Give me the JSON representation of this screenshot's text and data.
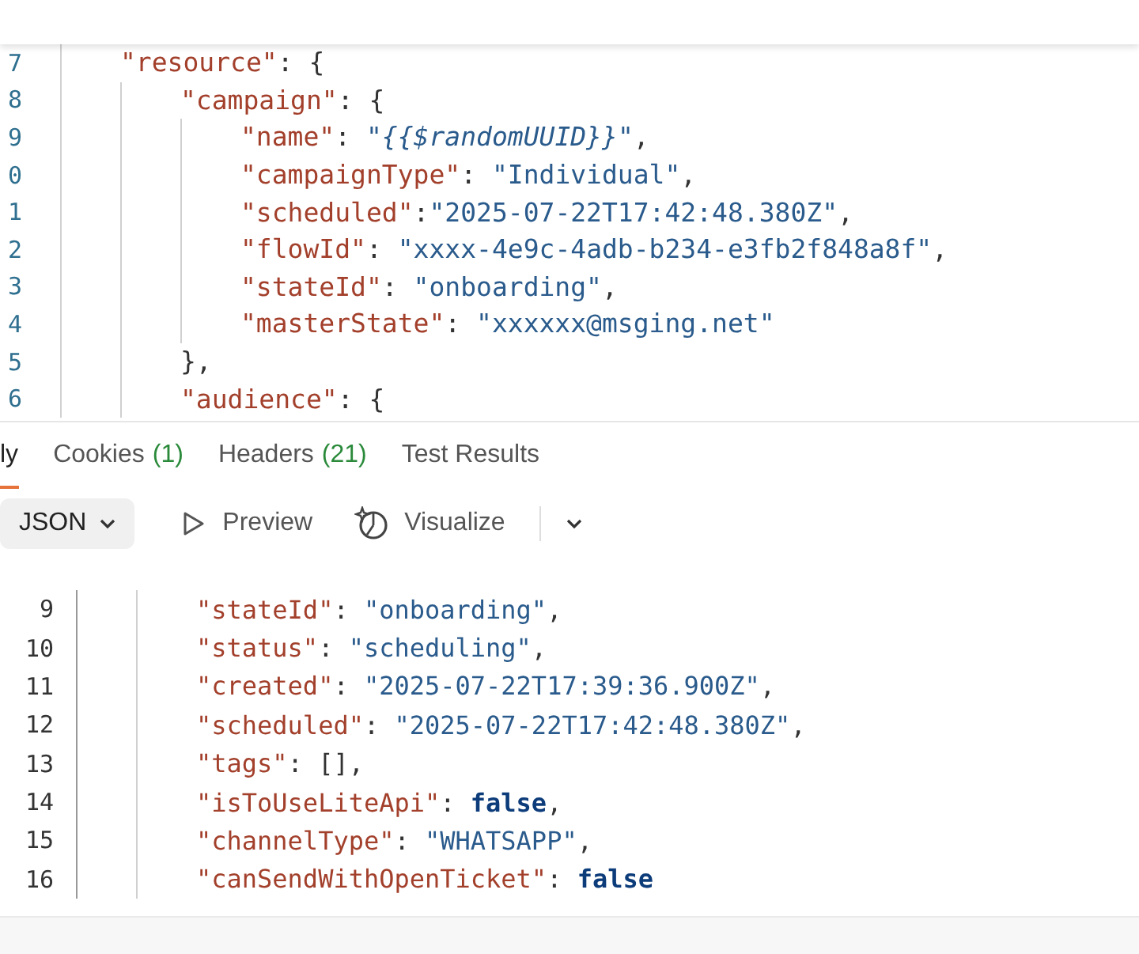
{
  "request_editor": {
    "lines": [
      {
        "number": "7",
        "tokens": [
          {
            "kind": "key",
            "text": "\"resource\""
          },
          {
            "kind": "punct",
            "text": ": {"
          }
        ],
        "children": [
          {
            "number": "8",
            "tokens": [
              {
                "kind": "key",
                "text": "\"campaign\""
              },
              {
                "kind": "punct",
                "text": ": {"
              }
            ],
            "children": [
              {
                "number": "9",
                "tokens": [
                  {
                    "kind": "key",
                    "text": "\"name\""
                  },
                  {
                    "kind": "punct",
                    "text": ": "
                  },
                  {
                    "kind": "string",
                    "text": "\""
                  },
                  {
                    "kind": "variable",
                    "text": "{{$randomUUID}}"
                  },
                  {
                    "kind": "string",
                    "text": "\""
                  },
                  {
                    "kind": "punct",
                    "text": ","
                  }
                ]
              },
              {
                "number": "0",
                "tokens": [
                  {
                    "kind": "key",
                    "text": "\"campaignType\""
                  },
                  {
                    "kind": "punct",
                    "text": ": "
                  },
                  {
                    "kind": "string",
                    "text": "\"Individual\""
                  },
                  {
                    "kind": "punct",
                    "text": ","
                  }
                ]
              },
              {
                "number": "1",
                "tokens": [
                  {
                    "kind": "key",
                    "text": "\"scheduled\""
                  },
                  {
                    "kind": "punct",
                    "text": ":"
                  },
                  {
                    "kind": "string",
                    "text": "\"2025-07-22T17:42:48.380Z\""
                  },
                  {
                    "kind": "punct",
                    "text": ","
                  }
                ]
              },
              {
                "number": "2",
                "tokens": [
                  {
                    "kind": "key",
                    "text": "\"flowId\""
                  },
                  {
                    "kind": "punct",
                    "text": ": "
                  },
                  {
                    "kind": "string",
                    "text": "\"xxxx-4e9c-4adb-b234-e3fb2f848a8f\""
                  },
                  {
                    "kind": "punct",
                    "text": ","
                  }
                ]
              },
              {
                "number": "3",
                "tokens": [
                  {
                    "kind": "key",
                    "text": "\"stateId\""
                  },
                  {
                    "kind": "punct",
                    "text": ": "
                  },
                  {
                    "kind": "string",
                    "text": "\"onboarding\""
                  },
                  {
                    "kind": "punct",
                    "text": ","
                  }
                ]
              },
              {
                "number": "4",
                "tokens": [
                  {
                    "kind": "key",
                    "text": "\"masterState\""
                  },
                  {
                    "kind": "punct",
                    "text": ": "
                  },
                  {
                    "kind": "string",
                    "text": "\"xxxxxx@msging.net\""
                  }
                ]
              }
            ]
          },
          {
            "number": "5",
            "tokens": [
              {
                "kind": "punct",
                "text": "},"
              }
            ]
          },
          {
            "number": "6",
            "tokens": [
              {
                "kind": "key",
                "text": "\"audience\""
              },
              {
                "kind": "punct",
                "text": ": {"
              }
            ]
          }
        ]
      }
    ]
  },
  "response_tabs": [
    {
      "label": "ly",
      "selected": true
    },
    {
      "label": "Cookies",
      "count": "(1)",
      "selected": false
    },
    {
      "label": "Headers",
      "count": "(21)",
      "selected": false
    },
    {
      "label": "Test Results",
      "selected": false
    }
  ],
  "response_toolbar": {
    "format": "JSON",
    "preview": "Preview",
    "visualize": "Visualize"
  },
  "response_body": {
    "lines": [
      {
        "number": "9",
        "tokens": [
          {
            "kind": "key",
            "text": "\"stateId\""
          },
          {
            "kind": "punct",
            "text": ": "
          },
          {
            "kind": "string",
            "text": "\"onboarding\""
          },
          {
            "kind": "punct",
            "text": ","
          }
        ]
      },
      {
        "number": "10",
        "tokens": [
          {
            "kind": "key",
            "text": "\"status\""
          },
          {
            "kind": "punct",
            "text": ": "
          },
          {
            "kind": "string",
            "text": "\"scheduling\""
          },
          {
            "kind": "punct",
            "text": ","
          }
        ]
      },
      {
        "number": "11",
        "tokens": [
          {
            "kind": "key",
            "text": "\"created\""
          },
          {
            "kind": "punct",
            "text": ": "
          },
          {
            "kind": "string",
            "text": "\"2025-07-22T17:39:36.900Z\""
          },
          {
            "kind": "punct",
            "text": ","
          }
        ]
      },
      {
        "number": "12",
        "tokens": [
          {
            "kind": "key",
            "text": "\"scheduled\""
          },
          {
            "kind": "punct",
            "text": ": "
          },
          {
            "kind": "string",
            "text": "\"2025-07-22T17:42:48.380Z\""
          },
          {
            "kind": "punct",
            "text": ","
          }
        ]
      },
      {
        "number": "13",
        "tokens": [
          {
            "kind": "key",
            "text": "\"tags\""
          },
          {
            "kind": "punct",
            "text": ": [],"
          }
        ]
      },
      {
        "number": "14",
        "tokens": [
          {
            "kind": "key",
            "text": "\"isToUseLiteApi\""
          },
          {
            "kind": "punct",
            "text": ": "
          },
          {
            "kind": "keyword",
            "text": "false"
          },
          {
            "kind": "punct",
            "text": ","
          }
        ]
      },
      {
        "number": "15",
        "tokens": [
          {
            "kind": "key",
            "text": "\"channelType\""
          },
          {
            "kind": "punct",
            "text": ": "
          },
          {
            "kind": "string",
            "text": "\"WHATSAPP\""
          },
          {
            "kind": "punct",
            "text": ","
          }
        ]
      },
      {
        "number": "16",
        "tokens": [
          {
            "kind": "key",
            "text": "\"canSendWithOpenTicket\""
          },
          {
            "kind": "punct",
            "text": ": "
          },
          {
            "kind": "keyword",
            "text": "false"
          }
        ]
      }
    ]
  }
}
